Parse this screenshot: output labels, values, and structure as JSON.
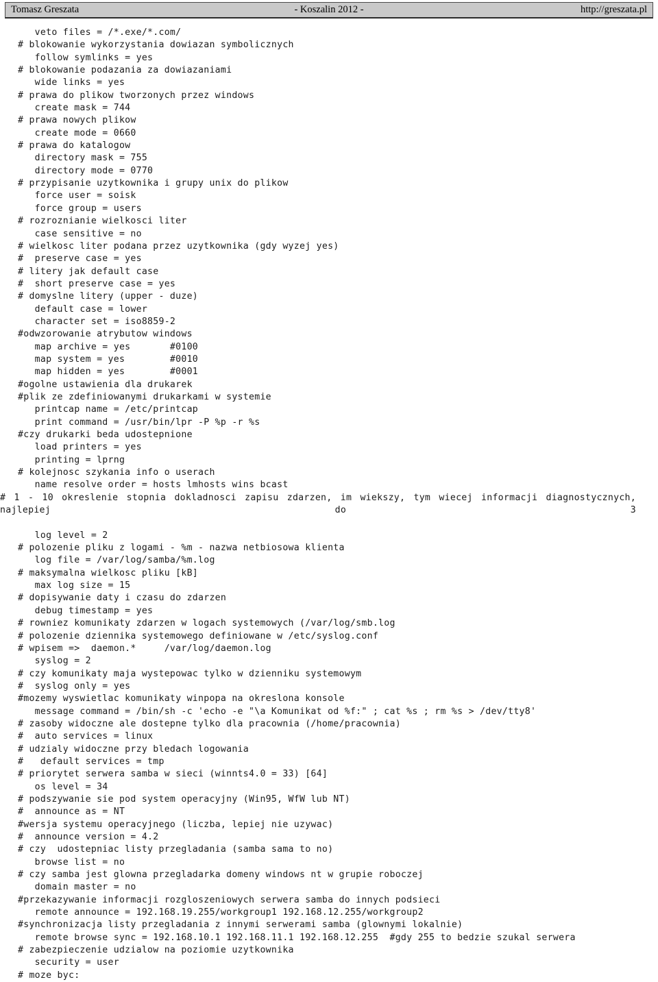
{
  "header": {
    "left": "Tomasz Greszata",
    "center": "- Koszalin 2012 -",
    "right": "http://greszata.pl",
    "background_color": "#c9c9c9",
    "border_color": "#2b2b2b"
  },
  "document": {
    "kind": "samba-smb-conf-listing",
    "text_color": "#1a1a1a",
    "background_color": "#ffffff",
    "lines": [
      "   veto files = /*.exe/*.com/",
      "# blokowanie wykorzystania dowiazan symbolicznych",
      "   follow symlinks = yes",
      "# blokowanie podazania za dowiazaniami",
      "   wide links = yes",
      "# prawa do plikow tworzonych przez windows",
      "   create mask = 744",
      "# prawa nowych plikow",
      "   create mode = 0660",
      "# prawa do katalogow",
      "   directory mask = 755",
      "   directory mode = 0770",
      "# przypisanie uzytkownika i grupy unix do plikow",
      "   force user = soisk",
      "   force group = users",
      "# rozroznianie wielkosci liter",
      "   case sensitive = no",
      "# wielkosc liter podana przez uzytkownika (gdy wyzej yes)",
      "#  preserve case = yes",
      "# litery jak default case",
      "#  short preserve case = yes",
      "# domyslne litery (upper - duze)",
      "   default case = lower",
      "   character set = iso8859-2",
      "#odwzorowanie atrybutow windows",
      "   map archive = yes       #0100",
      "   map system = yes        #0010",
      "   map hidden = yes        #0001",
      "#ogolne ustawienia dla drukarek",
      "#plik ze zdefiniowanymi drukarkami w systemie",
      "   printcap name = /etc/printcap",
      "   print command = /usr/bin/lpr -P %p -r %s",
      "#czy drukarki beda udostepnione",
      "   load printers = yes",
      "   printing = lprng",
      "# kolejnosc szykania info o userach",
      "   name resolve order = hosts lmhosts wins bcast",
      {
        "wrapped": true,
        "text": "# 1 - 10 okreslenie stopnia dokladnosci zapisu zdarzen, im wiekszy, tym wiecej informacji diagnostycznych, najlepiej do 3"
      },
      "   log level = 2",
      "# polozenie pliku z logami - %m - nazwa netbiosowa klienta",
      "   log file = /var/log/samba/%m.log",
      "# maksymalna wielkosc pliku [kB]",
      "   max log size = 15",
      "# dopisywanie daty i czasu do zdarzen",
      "   debug timestamp = yes",
      "# rowniez komunikaty zdarzen w logach systemowych (/var/log/smb.log",
      "# polozenie dziennika systemowego definiowane w /etc/syslog.conf",
      "# wpisem =>  daemon.*     /var/log/daemon.log",
      "   syslog = 2",
      "# czy komunikaty maja wystepowac tylko w dzienniku systemowym",
      "#  syslog only = yes",
      "#mozemy wyswietlac komunikaty winpopa na okreslona konsole",
      "   message command = /bin/sh -c 'echo -e \"\\a Komunikat od %f:\" ; cat %s ; rm %s > /dev/tty8'",
      "# zasoby widoczne ale dostepne tylko dla pracownia (/home/pracownia)",
      "#  auto services = linux",
      "# udzialy widoczne przy bledach logowania",
      "#   default services = tmp",
      "# priorytet serwera samba w sieci (winnts4.0 = 33) [64]",
      "   os level = 34",
      "# podszywanie sie pod system operacyjny (Win95, WfW lub NT)",
      "#  announce as = NT",
      "#wersja systemu operacyjnego (liczba, lepiej nie uzywac)",
      "#  announce version = 4.2",
      "# czy  udostepniac listy przegladania (samba sama to no)",
      "   browse list = no",
      "# czy samba jest glowna przegladarka domeny windows nt w grupie roboczej",
      "   domain master = no",
      "#przekazywanie informacji rozgloszeniowych serwera samba do innych podsieci",
      "   remote announce = 192.168.19.255/workgroup1 192.168.12.255/workgroup2",
      "#synchronizacja listy przegladania z innymi serwerami samba (glownymi lokalnie)",
      "   remote browse sync = 192.168.10.1 192.168.11.1 192.168.12.255  #gdy 255 to bedzie szukal serwera",
      "# zabezpieczenie udzialow na poziomie uzytkownika",
      "   security = user",
      "# moze byc:"
    ]
  }
}
